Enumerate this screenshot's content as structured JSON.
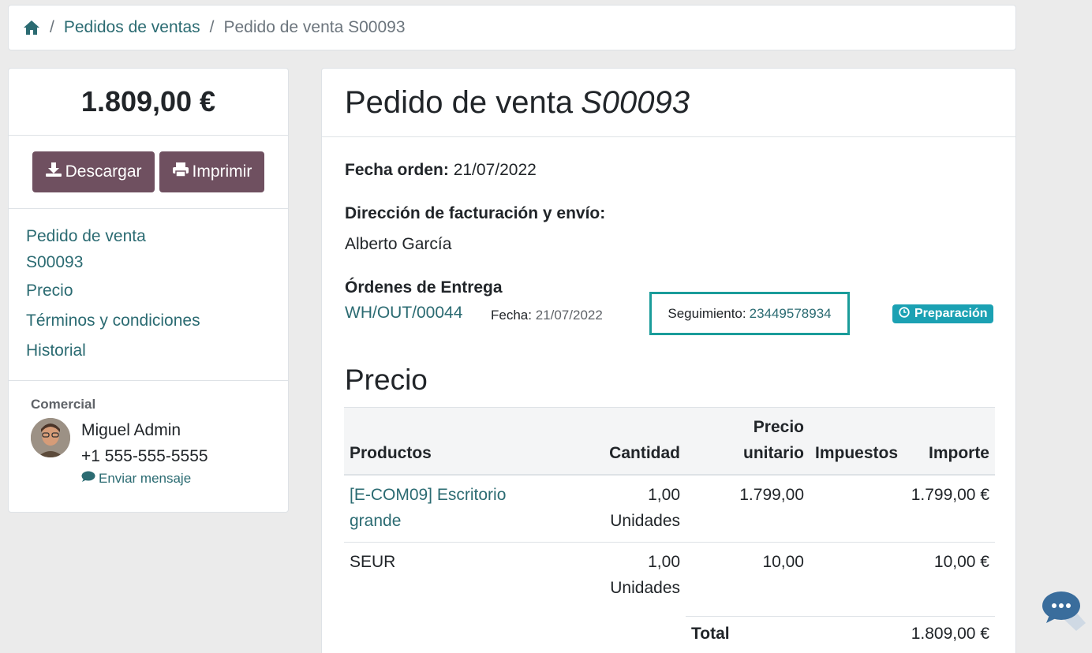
{
  "breadcrumb": {
    "home_icon": "home-icon",
    "separator": "/",
    "items": [
      {
        "label": "Pedidos de ventas"
      },
      {
        "label": "Pedido de venta S00093"
      }
    ]
  },
  "sidebar": {
    "total": "1.809,00 €",
    "download_label": "Descargar",
    "print_label": "Imprimir",
    "nav": [
      {
        "label_line1": "Pedido de venta",
        "label_line2": "S00093"
      },
      {
        "label": "Precio"
      },
      {
        "label": "Términos y condiciones"
      },
      {
        "label": "Historial"
      }
    ],
    "salesperson": {
      "heading": "Comercial",
      "name": "Miguel Admin",
      "phone": "+1 555-555-5555",
      "send_message": "Enviar mensaje"
    }
  },
  "order": {
    "title_prefix": "Pedido de venta",
    "title_number": "S00093",
    "order_date_label": "Fecha orden:",
    "order_date_value": "21/07/2022",
    "address_label": "Dirección de facturación y envío:",
    "address_name": "Alberto García",
    "deliveries_label": "Órdenes de Entrega",
    "delivery": {
      "ref": "WH/OUT/00044",
      "date_label": "Fecha:",
      "date_value": "21/07/2022",
      "tracking_label": "Seguimiento:",
      "tracking_value": "23449578934",
      "status": "Preparación"
    },
    "price_section_title": "Precio",
    "table": {
      "headers": {
        "products": "Productos",
        "quantity": "Cantidad",
        "unit_price_l1": "Precio",
        "unit_price_l2": "unitario",
        "taxes": "Impuestos",
        "amount": "Importe"
      },
      "rows": [
        {
          "product_l1": "[E-COM09] Escritorio",
          "product_l2": "grande",
          "qty_l1": "1,00",
          "qty_l2": "Unidades",
          "unit_price": "1.799,00",
          "taxes": "",
          "amount": "1.799,00 €"
        },
        {
          "product_l1": "SEUR",
          "product_l2": "",
          "qty_l1": "1,00",
          "qty_l2": "Unidades",
          "unit_price": "10,00",
          "taxes": "",
          "amount": "10,00 €"
        }
      ]
    },
    "total_label": "Total",
    "total_value": "1.809,00 €"
  },
  "colors": {
    "link": "#2b6b72",
    "primary_button": "#6f5060",
    "badge": "#1ba1b3",
    "highlight_border": "#1a9c9a"
  }
}
